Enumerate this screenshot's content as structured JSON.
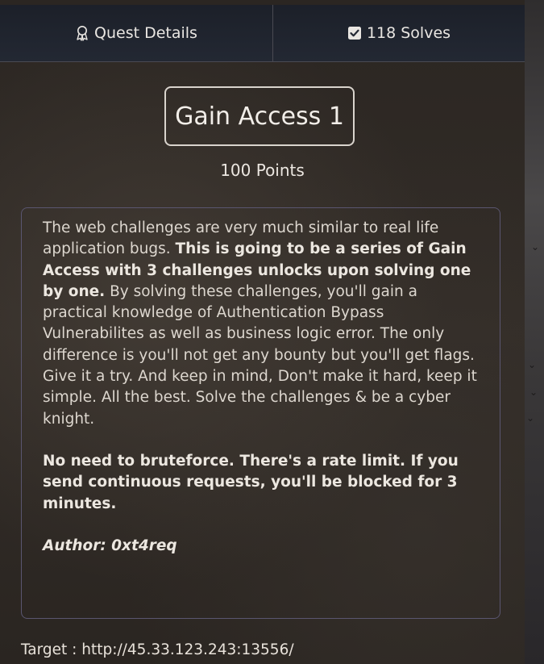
{
  "tabs": {
    "details_label": "Quest Details",
    "solves_label": "118 Solves"
  },
  "challenge": {
    "title": "Gain Access 1",
    "points": "100 Points"
  },
  "description": {
    "part1": "The web challenges are very much similar to real life application bugs. ",
    "part2_bold": "This is going to be a series of Gain Access with 3 challenges unlocks upon solving one by one.",
    "part3": " By solving these challenges, you'll gain a practical knowledge of Authentication Bypass Vulnerabilites as well as business logic error. The only difference is you'll not get any bounty but you'll get flags. Give it a try. And keep in mind, Don't make it hard, keep it simple. All the best. Solve the challenges & be a cyber knight.",
    "warning": "No need to bruteforce. There's a rate limit. If you send continuous requests, you'll be blocked for 3 minutes.",
    "author": "Author: 0xt4req"
  },
  "target": {
    "label": "Target : ",
    "url": "http://45.33.123.243:13556/"
  },
  "icons": {
    "details": "medal-icon",
    "solves": "checkbox-icon"
  }
}
